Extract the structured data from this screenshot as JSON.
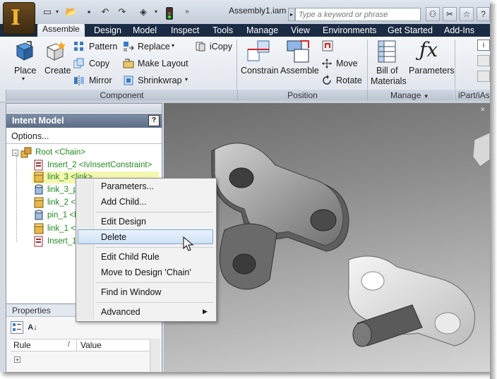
{
  "window": {
    "document_title": "Assembly1.iam",
    "search_placeholder": "Type a keyword or phrase",
    "app_button_letter": "I"
  },
  "ribbon_tabs": [
    "Assemble",
    "Design",
    "Model",
    "Inspect",
    "Tools",
    "Manage",
    "View",
    "Environments",
    "Get Started",
    "Add-Ins"
  ],
  "ribbon": {
    "place": "Place",
    "create": "Create",
    "pattern": "Pattern",
    "copy": "Copy",
    "mirror": "Mirror",
    "replace": "Replace",
    "make_layout": "Make Layout",
    "shrinkwrap": "Shrinkwrap",
    "icopy": "iCopy",
    "constrain": "Constrain",
    "assemble": "Assemble",
    "move": "Move",
    "rotate": "Rotate",
    "bom_line1": "Bill of",
    "bom_line2": "Materials",
    "parameters": "Parameters",
    "panel_component": "Component",
    "panel_position": "Position",
    "panel_manage": "Manage",
    "panel_ipart": "iPart/iAs"
  },
  "intent_model": {
    "title": "Intent Model",
    "help": "?",
    "options": "Options...",
    "tree": [
      "Root <Chain>",
      "Insert_2 <IvInsertConstraint>",
      "link_3 <link>",
      "link_3_p",
      "link_2 <l",
      "pin_1 <l",
      "link_1 <l",
      "Insert_1"
    ]
  },
  "properties": {
    "title": "Properties",
    "col_rule": "Rule",
    "col_value": "Value",
    "expand": "+"
  },
  "context_menu": {
    "parameters": "Parameters...",
    "add_child": "Add Child...",
    "edit_design": "Edit Design",
    "delete": "Delete",
    "edit_child_rule": "Edit Child Rule",
    "move_to_design": "Move to Design 'Chain'",
    "find_in_window": "Find in Window",
    "advanced": "Advanced"
  },
  "colors": {
    "tree_text": "#1f8a1f",
    "tab_bar": "#1a2b43",
    "highlight": "#cfe2f6"
  }
}
